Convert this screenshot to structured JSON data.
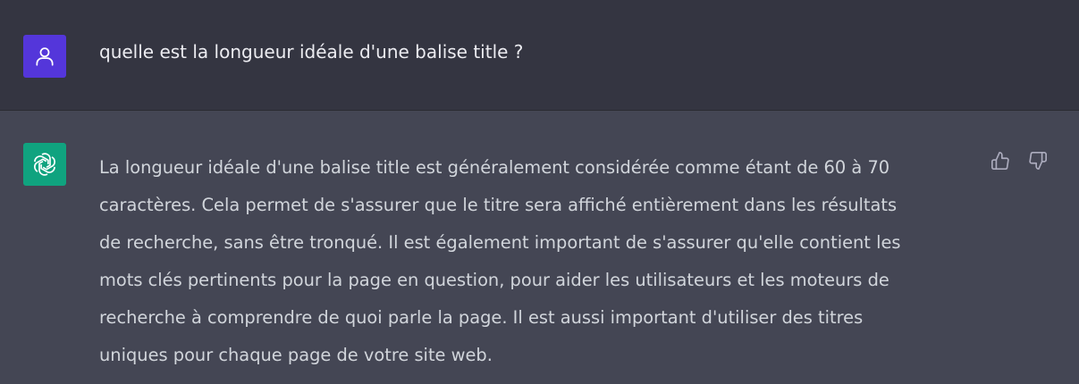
{
  "conversation": {
    "user_message": {
      "avatar_icon": "user-icon",
      "avatar_color": "#5436da",
      "text": "quelle est la longueur idéale d'une balise title ?"
    },
    "assistant_message": {
      "avatar_icon": "openai-logo-icon",
      "avatar_color": "#10a37f",
      "lines": [
        "La longueur idéale d'une balise title est généralement considérée comme étant de 60 à 70",
        "caractères. Cela permet de s'assurer que le titre sera affiché entièrement dans les résultats",
        "de recherche, sans être tronqué. Il est également important de s'assurer qu'elle contient les",
        "mots clés pertinents pour la page en question, pour aider les utilisateurs et les moteurs de",
        "recherche à comprendre de quoi parle la page. Il est aussi important d'utiliser des titres",
        "uniques pour chaque page de votre site web."
      ],
      "feedback": {
        "thumbs_up_icon": "thumbs-up-icon",
        "thumbs_down_icon": "thumbs-down-icon"
      }
    }
  },
  "colors": {
    "user_row_bg": "#343541",
    "assistant_row_bg": "#444654",
    "text": "#d1d5db"
  }
}
